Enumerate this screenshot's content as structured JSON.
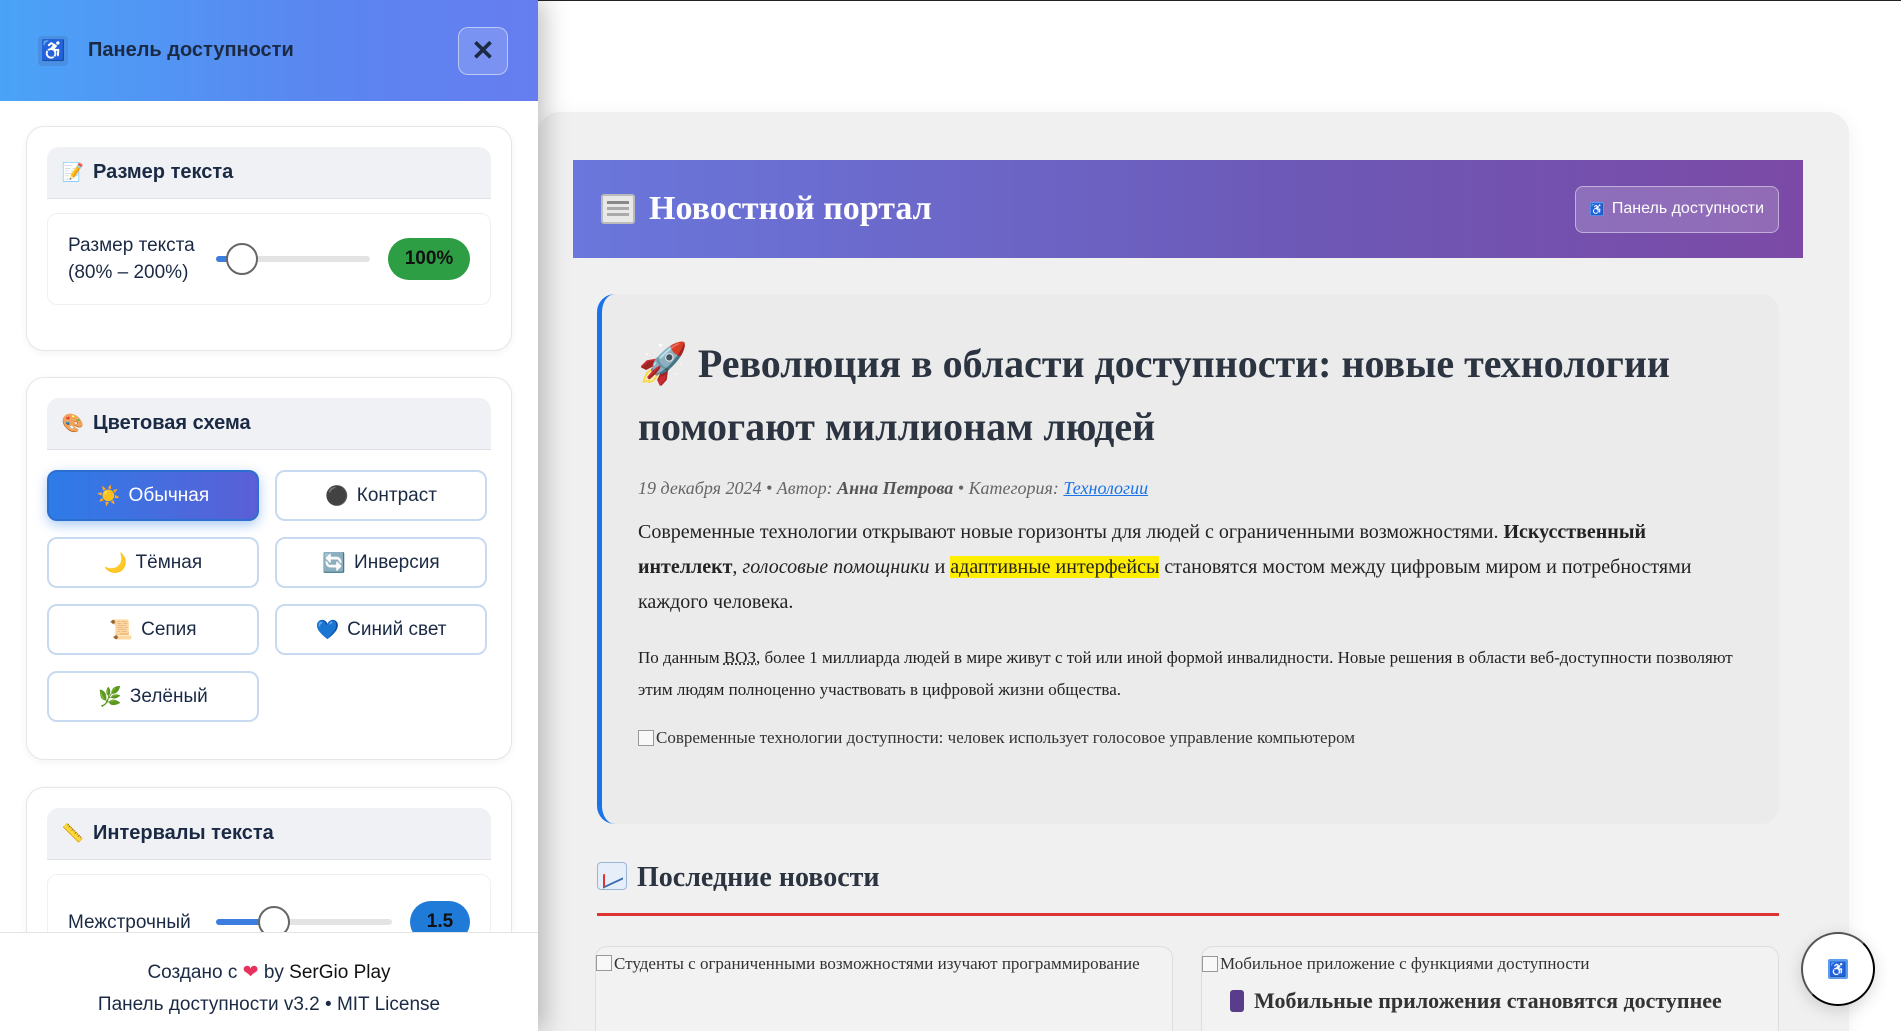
{
  "panel": {
    "title": "Панель доступности",
    "close_label": "✕",
    "sections": {
      "text_size": {
        "heading": "Размер текста",
        "heading_icon": "pencil-emoji",
        "slider_label": "Размер текста (80% – 200%)",
        "value": "100%",
        "level_fraction": 0.17
      },
      "color_scheme": {
        "heading": "Цветовая схема",
        "heading_icon": "palette-emoji",
        "buttons": [
          {
            "icon": "☀️",
            "label": "Обычная",
            "active": true
          },
          {
            "icon": "⚫",
            "label": "Контраст",
            "active": false
          },
          {
            "icon": "🌙",
            "label": "Тёмная",
            "active": false
          },
          {
            "icon": "🔄",
            "label": "Инверсия",
            "active": false
          },
          {
            "icon": "📜",
            "label": "Сепия",
            "active": false
          },
          {
            "icon": "💙",
            "label": "Синий свет",
            "active": false
          },
          {
            "icon": "🌿",
            "label": "Зелёный",
            "active": false
          }
        ]
      },
      "text_spacing": {
        "heading": "Интервалы текста",
        "heading_icon": "ruler-emoji",
        "slider_label": "Межстрочный",
        "value": "1.5",
        "level_fraction": 0.33
      }
    },
    "footer": {
      "made_with": "Создано с",
      "by": "by",
      "author": "SerGio Play",
      "version_line": "Панель доступности v3.2 • MIT License"
    }
  },
  "site": {
    "title": "Новостной портал",
    "access_button": "Панель доступности",
    "article": {
      "title": "Революция в области доступности: новые технологии помогают миллионам людей",
      "date": "19 декабря 2024",
      "author_label": "Автор:",
      "author": "Анна Петрова",
      "category_label": "Категория:",
      "category": "Технологии",
      "lead_1": "Современные технологии открывают новые горизонты для людей с ограниченными возможностями.",
      "lead_bold": "Искусственный интеллект",
      "lead_italic": "голосовые помощники",
      "lead_and": "и",
      "lead_highlight": "адаптивные интерфейсы",
      "lead_2": "становятся мостом между цифровым миром и потребностями каждого человека.",
      "body_1": "По данным",
      "body_abbr": "ВОЗ",
      "body_2": ", более 1 миллиарда людей в мире живут с той или иной формой инвалидности. Новые решения в области веб-доступности позволяют этим людям полноценно участвовать в цифровой жизни общества.",
      "image_alt": "Современные технологии доступности: человек использует голосовое управление компьютером"
    },
    "news_heading": "Последние новости",
    "cards": [
      {
        "image_alt": "Студенты с ограниченными возможностями изучают программирование"
      },
      {
        "image_alt": "Мобильное приложение с функциями доступности",
        "title": "Мобильные приложения становятся доступнее"
      }
    ]
  }
}
